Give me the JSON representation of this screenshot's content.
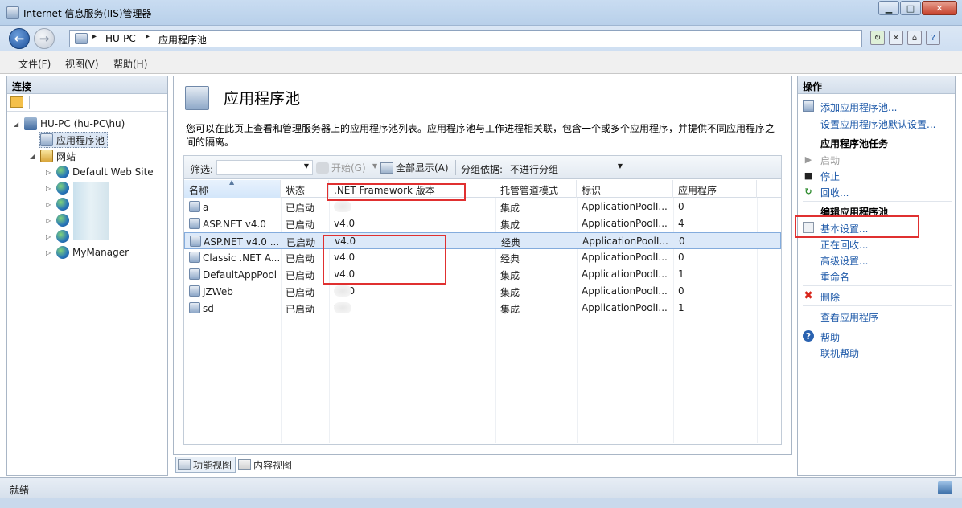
{
  "window": {
    "title": "Internet 信息服务(IIS)管理器",
    "min_label": "▁",
    "max_label": "□",
    "close_label": "✕"
  },
  "address": {
    "crumbs": [
      "HU-PC",
      "应用程序池"
    ],
    "separator": "▸"
  },
  "menu": [
    "文件(F)",
    "视图(V)",
    "帮助(H)"
  ],
  "connections": {
    "header": "连接",
    "tree": {
      "server": "HU-PC (hu-PC\\hu)",
      "pools": "应用程序池",
      "sites": "网站",
      "default_site": "Default Web Site",
      "my_manager": "MyManager"
    }
  },
  "center": {
    "title": "应用程序池",
    "description": "您可以在此页上查看和管理服务器上的应用程序池列表。应用程序池与工作进程相关联，包含一个或多个应用程序，并提供不同应用程序之间的隔离。",
    "filter_label": "筛选:",
    "start_label": "开始(G)",
    "show_all_label": "全部显示(A)",
    "group_by_label": "分组依据:",
    "group_by_value": "不进行分组",
    "columns": [
      "名称",
      "状态",
      ".NET Framework 版本",
      "托管管道模式",
      "标识",
      "应用程序"
    ],
    "rows": [
      {
        "name": "a",
        "status": "已启动",
        "version": "0",
        "pipeline": "集成",
        "identity": "ApplicationPoolI...",
        "apps": "0"
      },
      {
        "name": "ASP.NET v4.0",
        "status": "已启动",
        "version": "v4.0",
        "pipeline": "集成",
        "identity": "ApplicationPoolI...",
        "apps": "4"
      },
      {
        "name": "ASP.NET v4.0 ...",
        "status": "已启动",
        "version": "v4.0",
        "pipeline": "经典",
        "identity": "ApplicationPoolI...",
        "apps": "0"
      },
      {
        "name": "Classic .NET A...",
        "status": "已启动",
        "version": "v4.0",
        "pipeline": "经典",
        "identity": "ApplicationPoolI...",
        "apps": "0"
      },
      {
        "name": "DefaultAppPool",
        "status": "已启动",
        "version": "v4.0",
        "pipeline": "集成",
        "identity": "ApplicationPoolI...",
        "apps": "1"
      },
      {
        "name": "JZWeb",
        "status": "已启动",
        "version": "v4.0",
        "pipeline": "集成",
        "identity": "ApplicationPoolI...",
        "apps": "0"
      },
      {
        "name": "sd",
        "status": "已启动",
        "version": "v",
        "pipeline": "集成",
        "identity": "ApplicationPoolI...",
        "apps": "1"
      }
    ],
    "selected_row": 2
  },
  "view_tabs": [
    "功能视图",
    "内容视图"
  ],
  "actions": {
    "header": "操作",
    "add_pool": "添加应用程序池...",
    "set_defaults": "设置应用程序池默认设置...",
    "tasks_header": "应用程序池任务",
    "start": "启动",
    "stop": "停止",
    "recycle": "回收...",
    "edit_header": "编辑应用程序池",
    "basic": "基本设置...",
    "recycling": "正在回收...",
    "advanced": "高级设置...",
    "rename": "重命名",
    "delete": "删除",
    "view_apps": "查看应用程序",
    "help": "帮助",
    "online_help": "联机帮助"
  },
  "status": {
    "text": "就绪"
  },
  "colors": {
    "link": "#1c58a8",
    "highlight": "#e03030"
  }
}
